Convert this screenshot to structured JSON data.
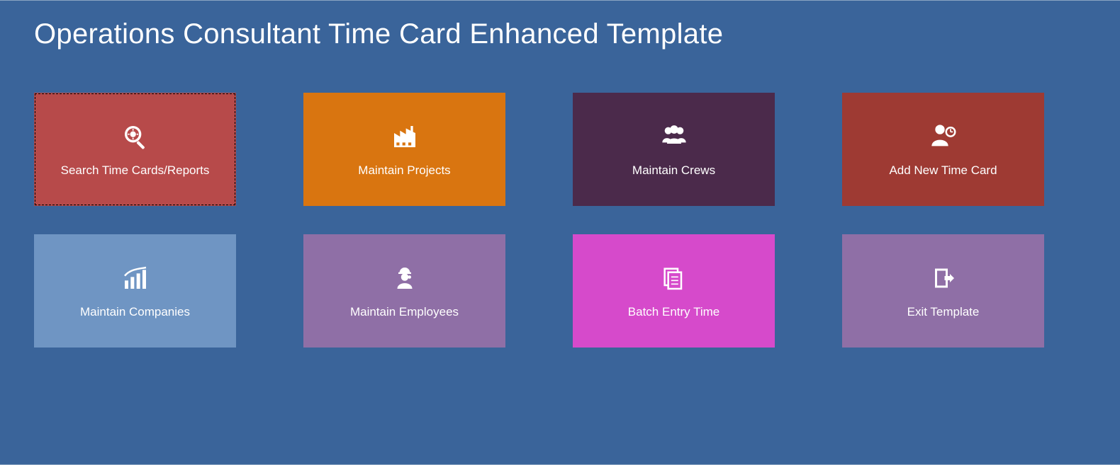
{
  "page": {
    "title": "Operations Consultant Time Card Enhanced Template"
  },
  "tiles": [
    {
      "label": "Search Time Cards/Reports",
      "icon": "magnifier-gear-icon",
      "color": "#b74a4a",
      "selected": true
    },
    {
      "label": "Maintain Projects",
      "icon": "factory-icon",
      "color": "#d97510",
      "selected": false
    },
    {
      "label": "Maintain Crews",
      "icon": "people-icon",
      "color": "#4b2a4b",
      "selected": false
    },
    {
      "label": "Add New Time Card",
      "icon": "person-clock-icon",
      "color": "#9e3a33",
      "selected": false
    },
    {
      "label": "Maintain Companies",
      "icon": "factory-chart-icon",
      "color": "#6f95c3",
      "selected": false
    },
    {
      "label": "Maintain Employees",
      "icon": "worker-icon",
      "color": "#8f6fa6",
      "selected": false
    },
    {
      "label": "Batch Entry Time",
      "icon": "documents-icon",
      "color": "#d64acb",
      "selected": false
    },
    {
      "label": "Exit Template",
      "icon": "exit-icon",
      "color": "#8f6fa6",
      "selected": false
    }
  ]
}
